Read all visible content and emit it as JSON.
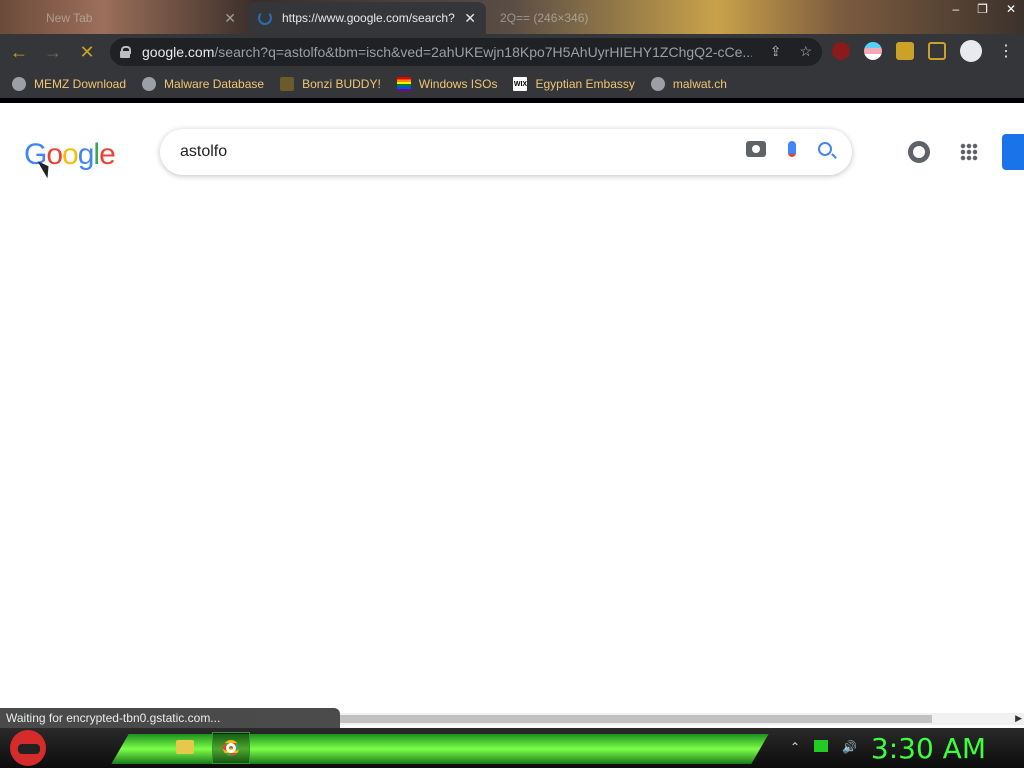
{
  "tabs": [
    {
      "title": "New Tab",
      "state": "inactive"
    },
    {
      "title": "https://www.google.com/search?",
      "state": "active"
    },
    {
      "title": "2Q== (246×346)",
      "state": "inactive"
    }
  ],
  "window_controls": {
    "minimize": "–",
    "restore": "❐",
    "close": "✕"
  },
  "nav": {
    "back": "←",
    "forward": "→",
    "stop": "✕"
  },
  "address": {
    "host": "google.com",
    "path": "/search?q=astolfo&tbm=isch&ved=2ahUKEwjn18Kpo7H5AhUyrHIEHY1ZChgQ2-cCe..."
  },
  "omnibox_icons": [
    "share-icon",
    "star-icon"
  ],
  "extensions": [
    "ublock-icon",
    "trans-flag-icon",
    "puzzle-icon",
    "side-panel-icon",
    "profile-icon"
  ],
  "bookmarks": [
    {
      "label": "MEMZ Download",
      "icon": "globe-icon"
    },
    {
      "label": "Malware Database",
      "icon": "globe-icon"
    },
    {
      "label": "Bonzi BUDDY!",
      "icon": "bonzi-icon"
    },
    {
      "label": "Windows ISOs",
      "icon": "rainbow-flag-icon"
    },
    {
      "label": "Egyptian Embassy",
      "icon": "wix-icon"
    },
    {
      "label": "malwat.ch",
      "icon": "globe-icon"
    }
  ],
  "google": {
    "logo": [
      "G",
      "o",
      "o",
      "g",
      "l",
      "e"
    ],
    "query": "astolfo"
  },
  "status_text": "Waiting for encrypted-tbn0.gstatic.com...",
  "taskbar": {
    "clock": "3:30 AM"
  },
  "colors": {
    "accent": "#c9a227",
    "google_blue": "#4285f4",
    "clock_green": "#3cff3c"
  }
}
